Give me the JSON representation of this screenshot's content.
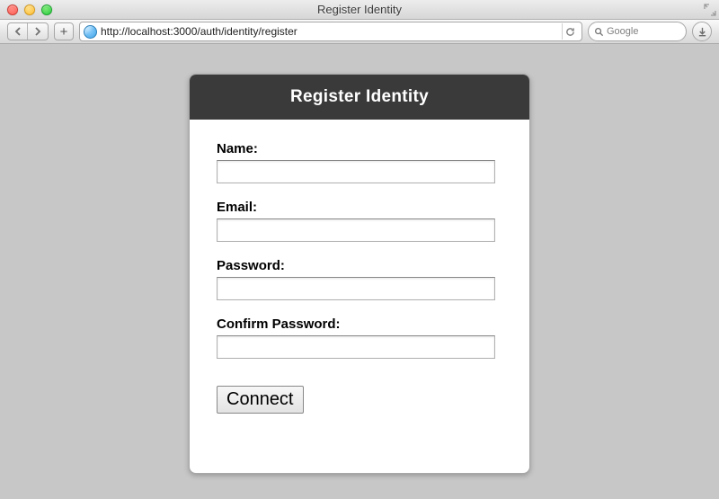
{
  "window": {
    "title": "Register Identity"
  },
  "toolbar": {
    "url": "http://localhost:3000/auth/identity/register",
    "search_placeholder": "Google"
  },
  "form": {
    "header": "Register Identity",
    "fields": {
      "name": {
        "label": "Name:",
        "value": ""
      },
      "email": {
        "label": "Email:",
        "value": ""
      },
      "password": {
        "label": "Password:",
        "value": ""
      },
      "confirm": {
        "label": "Confirm Password:",
        "value": ""
      }
    },
    "submit_label": "Connect"
  }
}
